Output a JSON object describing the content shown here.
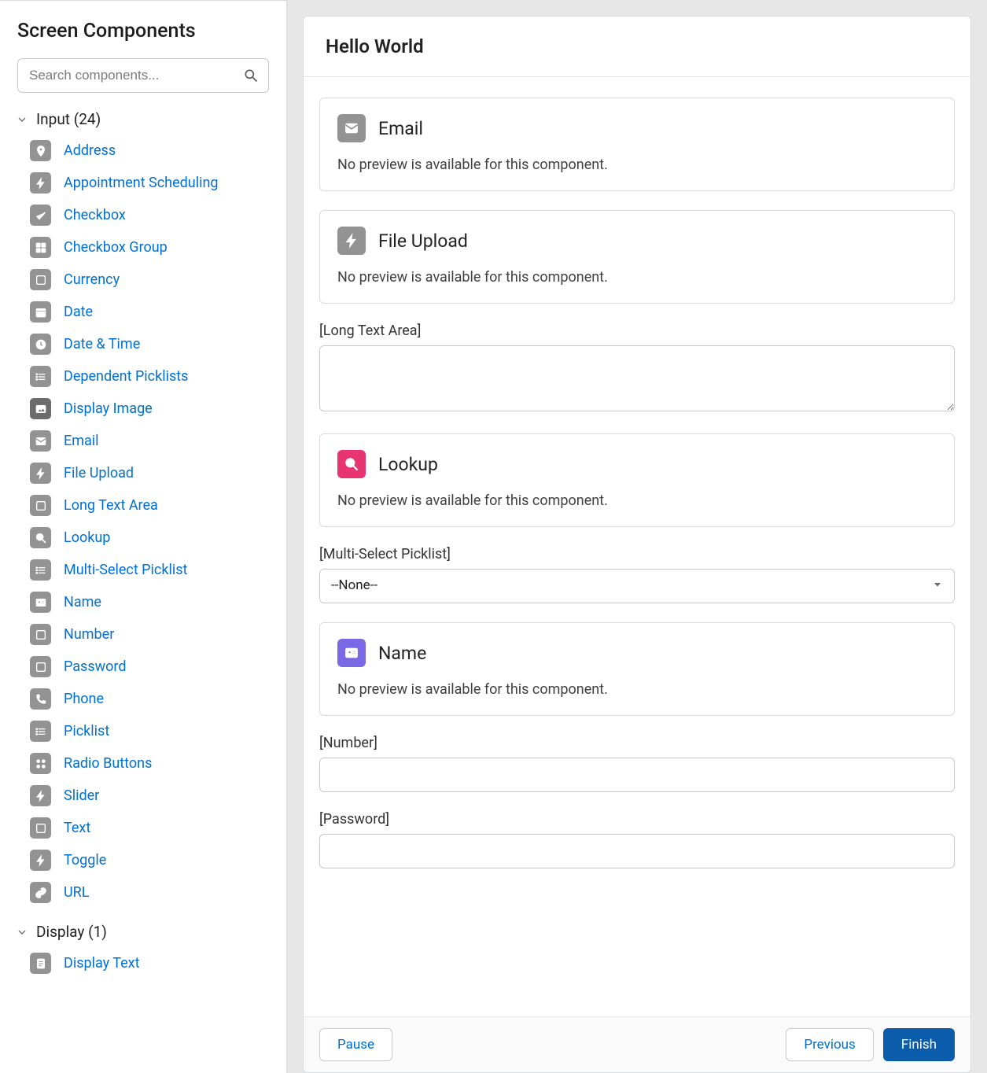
{
  "sidebar": {
    "title": "Screen Components",
    "search_placeholder": "Search components...",
    "groups": [
      {
        "key": "input",
        "label": "Input (24)",
        "items": [
          {
            "label": "Address",
            "icon": "location"
          },
          {
            "label": "Appointment Scheduling",
            "icon": "bolt"
          },
          {
            "label": "Checkbox",
            "icon": "check"
          },
          {
            "label": "Checkbox Group",
            "icon": "checkgroup"
          },
          {
            "label": "Currency",
            "icon": "box"
          },
          {
            "label": "Date",
            "icon": "calendar"
          },
          {
            "label": "Date & Time",
            "icon": "clock"
          },
          {
            "label": "Dependent Picklists",
            "icon": "list"
          },
          {
            "label": "Display Image",
            "icon": "image",
            "bg": "dark"
          },
          {
            "label": "Email",
            "icon": "mail"
          },
          {
            "label": "File Upload",
            "icon": "bolt"
          },
          {
            "label": "Long Text Area",
            "icon": "box"
          },
          {
            "label": "Lookup",
            "icon": "search"
          },
          {
            "label": "Multi-Select Picklist",
            "icon": "list"
          },
          {
            "label": "Name",
            "icon": "id"
          },
          {
            "label": "Number",
            "icon": "box"
          },
          {
            "label": "Password",
            "icon": "box"
          },
          {
            "label": "Phone",
            "icon": "phone"
          },
          {
            "label": "Picklist",
            "icon": "list"
          },
          {
            "label": "Radio Buttons",
            "icon": "radio"
          },
          {
            "label": "Slider",
            "icon": "bolt"
          },
          {
            "label": "Text",
            "icon": "box"
          },
          {
            "label": "Toggle",
            "icon": "bolt"
          },
          {
            "label": "URL",
            "icon": "link"
          }
        ]
      },
      {
        "key": "display",
        "label": "Display (1)",
        "items": [
          {
            "label": "Display Text",
            "icon": "doc"
          }
        ]
      }
    ]
  },
  "main": {
    "title": "Hello World",
    "no_preview_text": "No preview is available for this component.",
    "blocks": [
      {
        "type": "preview",
        "title": "Email",
        "icon": "mail",
        "bg": "gray"
      },
      {
        "type": "preview",
        "title": "File Upload",
        "icon": "bolt",
        "bg": "gray"
      },
      {
        "type": "textarea",
        "label": "[Long Text Area]"
      },
      {
        "type": "preview",
        "title": "Lookup",
        "icon": "search",
        "bg": "pink"
      },
      {
        "type": "select",
        "label": "[Multi-Select Picklist]",
        "value": "--None--"
      },
      {
        "type": "preview",
        "title": "Name",
        "icon": "id",
        "bg": "purple"
      },
      {
        "type": "input",
        "label": "[Number]"
      },
      {
        "type": "input",
        "label": "[Password]"
      }
    ],
    "footer": {
      "pause": "Pause",
      "previous": "Previous",
      "finish": "Finish"
    }
  }
}
